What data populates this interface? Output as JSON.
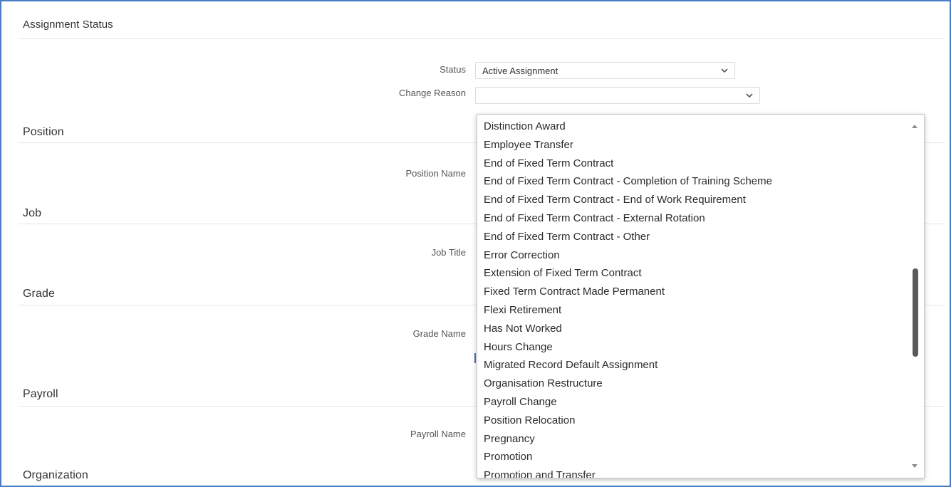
{
  "sections": {
    "assignment_status": "Assignment Status",
    "position": "Position",
    "job": "Job",
    "grade": "Grade",
    "payroll": "Payroll",
    "organization": "Organization"
  },
  "fields": {
    "status_label": "Status",
    "status_value": "Active Assignment",
    "change_reason_label": "Change Reason",
    "change_reason_value": "",
    "position_name_label": "Position Name",
    "job_title_label": "Job Title",
    "grade_name_label": "Grade Name",
    "payroll_name_label": "Payroll Name"
  },
  "dropdown": {
    "options": [
      "Distinction Award",
      "Employee Transfer",
      "End of Fixed Term Contract",
      "End of Fixed Term Contract - Completion of Training Scheme",
      "End of Fixed Term Contract - End of Work Requirement",
      "End of Fixed Term Contract - External Rotation",
      "End of Fixed Term Contract - Other",
      "Error Correction",
      "Extension of Fixed Term Contract",
      "Fixed Term Contract Made Permanent",
      "Flexi Retirement",
      "Has Not Worked",
      "Hours Change",
      "Migrated Record Default Assignment",
      "Organisation Restructure",
      "Payroll Change",
      "Position Relocation",
      "Pregnancy",
      "Promotion",
      "Promotion and Transfer"
    ]
  },
  "icons": {
    "select_chevron": "chevron-down-icon",
    "scroll_up": "scroll-up-arrow-icon",
    "scroll_down": "scroll-down-arrow-icon"
  },
  "colors": {
    "frame_border": "#4a7bc4",
    "scroll_thumb": "#5a5a5a"
  }
}
